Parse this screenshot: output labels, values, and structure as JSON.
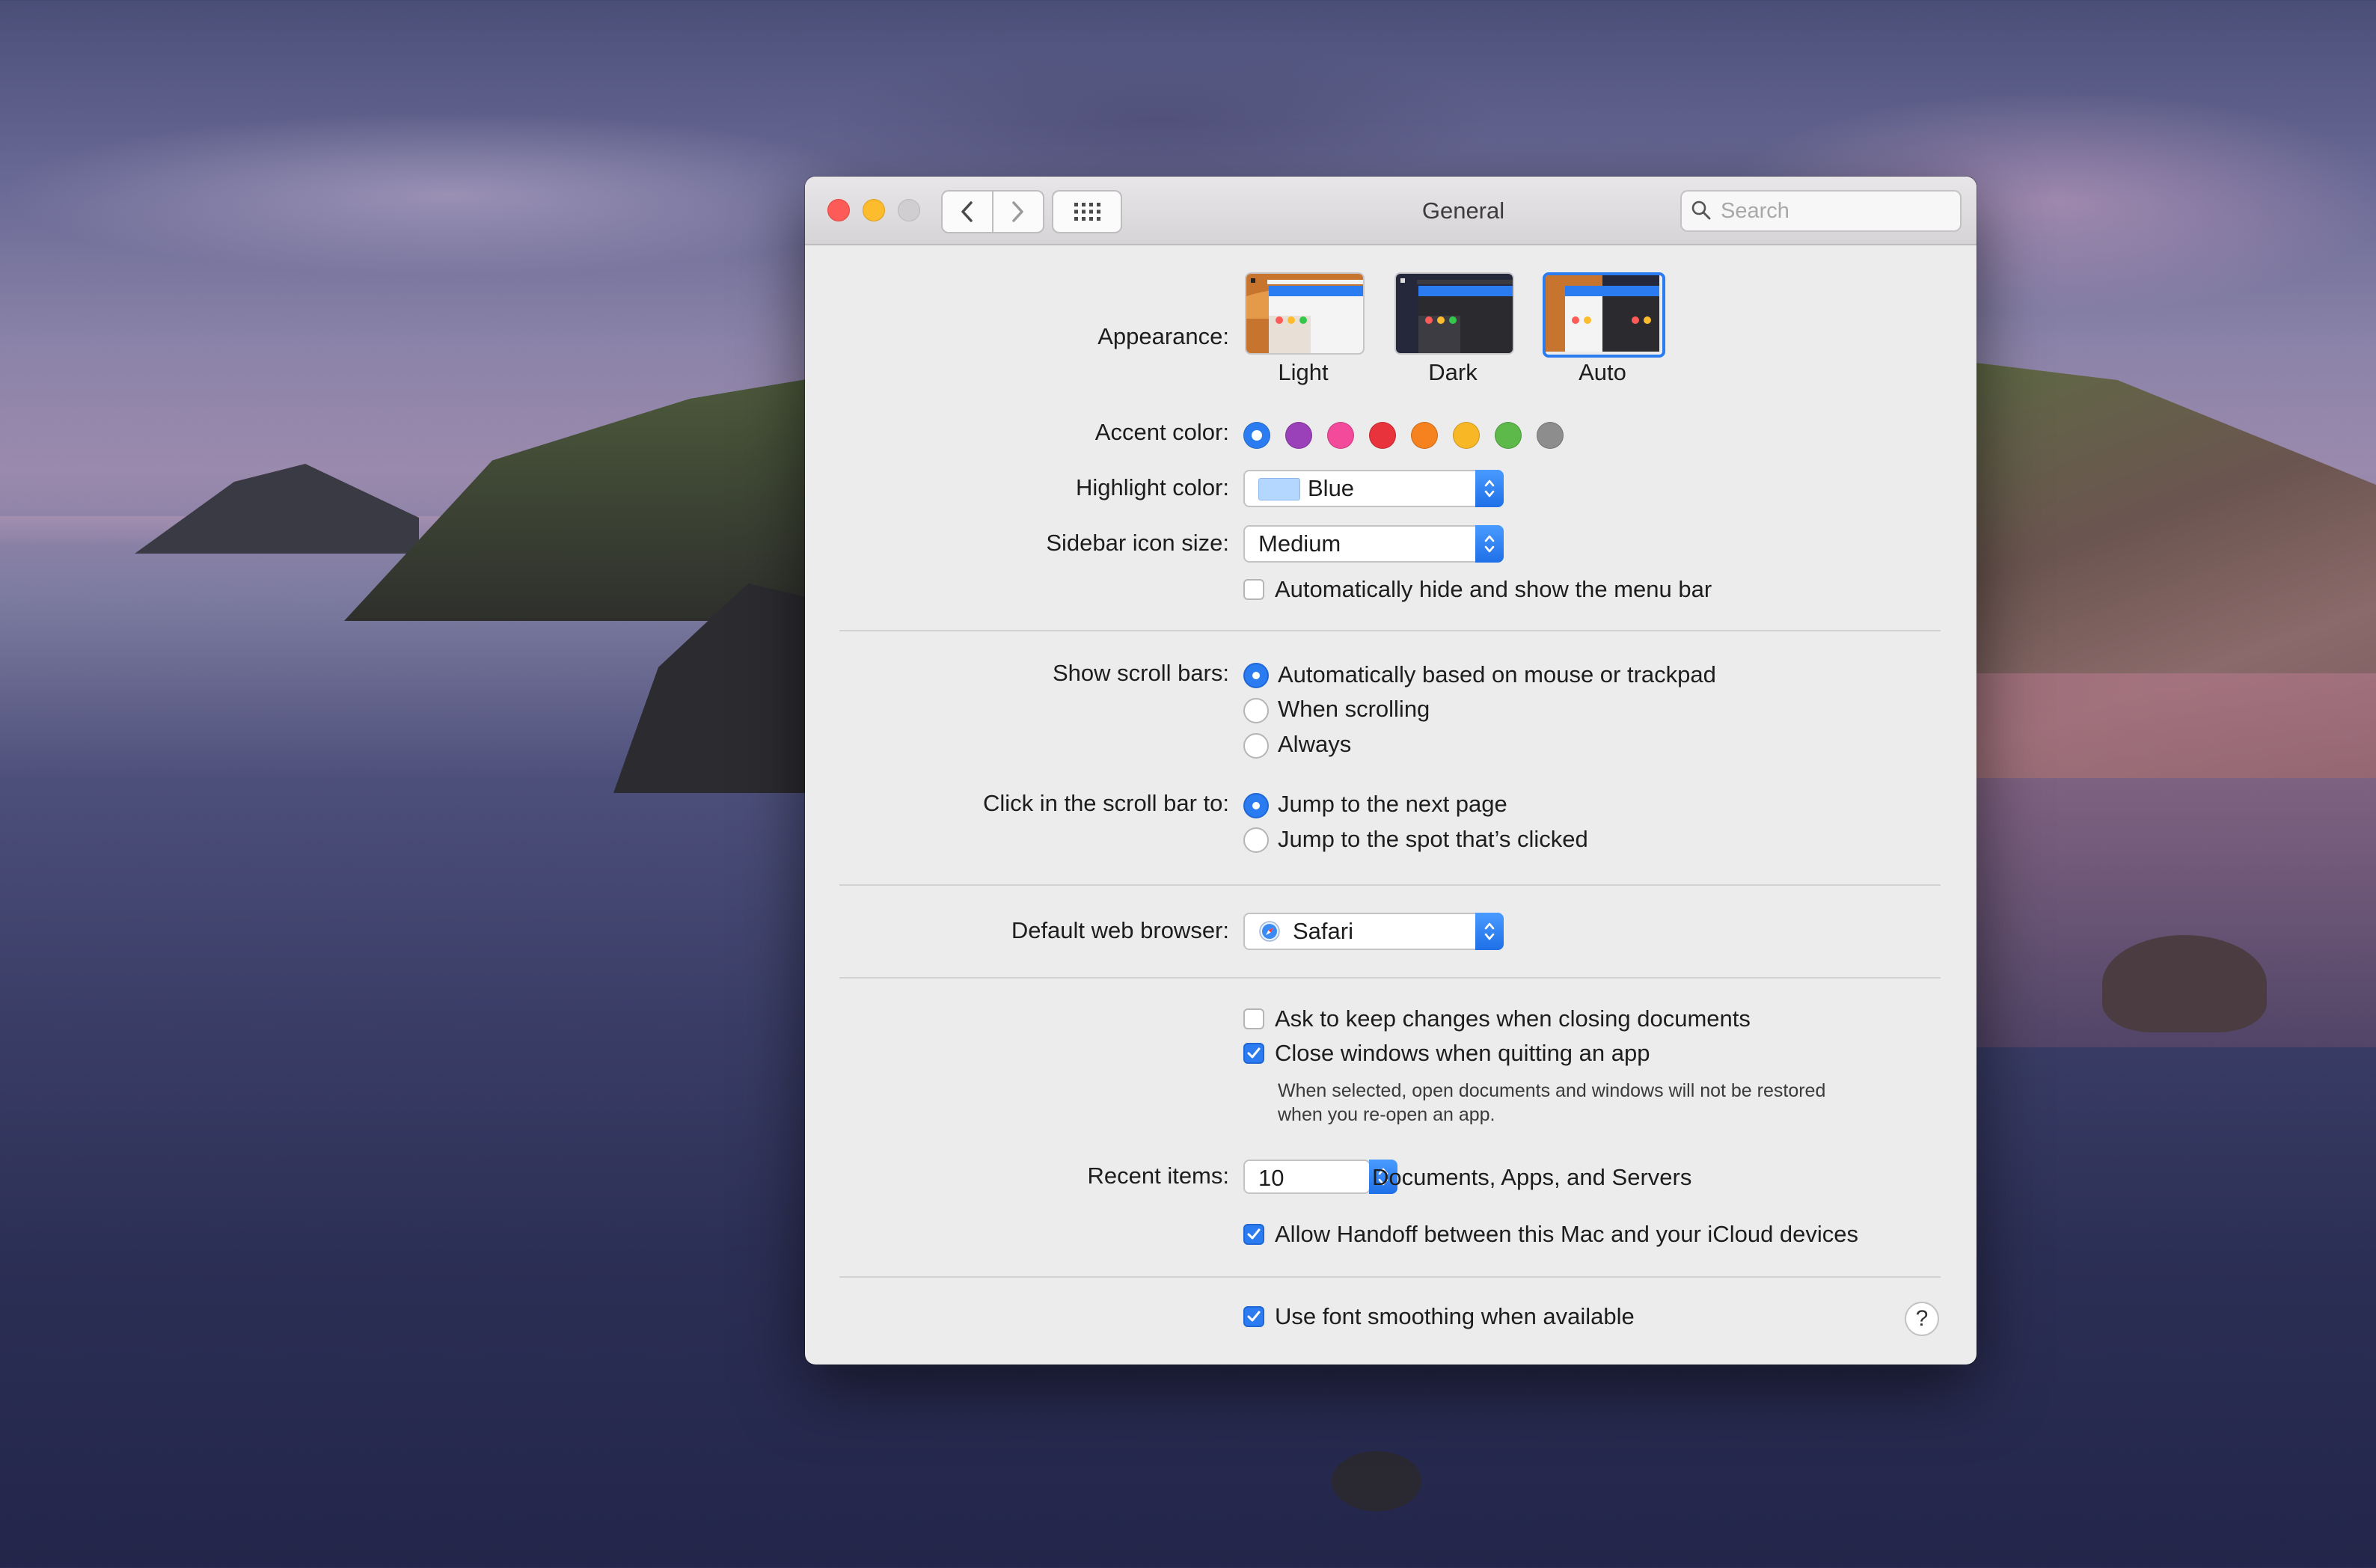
{
  "window": {
    "title": "General"
  },
  "search": {
    "placeholder": "Search"
  },
  "appearance": {
    "label": "Appearance:",
    "options": [
      {
        "label": "Light",
        "selected": false
      },
      {
        "label": "Dark",
        "selected": false
      },
      {
        "label": "Auto",
        "selected": true
      }
    ]
  },
  "accent": {
    "label": "Accent color:",
    "colors": [
      "#2b7cf0",
      "#9a40b8",
      "#f34a9c",
      "#e8323c",
      "#f6821f",
      "#f8b825",
      "#5cb94a",
      "#8d8d8d"
    ],
    "selected_index": 0
  },
  "highlight": {
    "label": "Highlight color:",
    "value": "Blue",
    "swatch": "#b4d7ff"
  },
  "sidebar_icon": {
    "label": "Sidebar icon size:",
    "value": "Medium"
  },
  "menu_bar": {
    "label": "Automatically hide and show the menu bar",
    "checked": false
  },
  "scroll_bars": {
    "label": "Show scroll bars:",
    "options": [
      {
        "label": "Automatically based on mouse or trackpad",
        "selected": true
      },
      {
        "label": "When scrolling",
        "selected": false
      },
      {
        "label": "Always",
        "selected": false
      }
    ]
  },
  "click_scroll": {
    "label": "Click in the scroll bar to:",
    "options": [
      {
        "label": "Jump to the next page",
        "selected": true
      },
      {
        "label": "Jump to the spot that’s clicked",
        "selected": false
      }
    ]
  },
  "browser": {
    "label": "Default web browser:",
    "value": "Safari"
  },
  "ask_keep": {
    "label": "Ask to keep changes when closing documents",
    "checked": false
  },
  "close_windows": {
    "label": "Close windows when quitting an app",
    "checked": true,
    "note_line1": "When selected, open documents and windows will not be restored",
    "note_line2": "when you re-open an app."
  },
  "recent": {
    "label": "Recent items:",
    "value": "10",
    "suffix": "Documents, Apps, and Servers"
  },
  "handoff": {
    "label": "Allow Handoff between this Mac and your iCloud devices",
    "checked": true
  },
  "font_smoothing": {
    "label": "Use font smoothing when available",
    "checked": true
  },
  "help": {
    "label": "?"
  }
}
